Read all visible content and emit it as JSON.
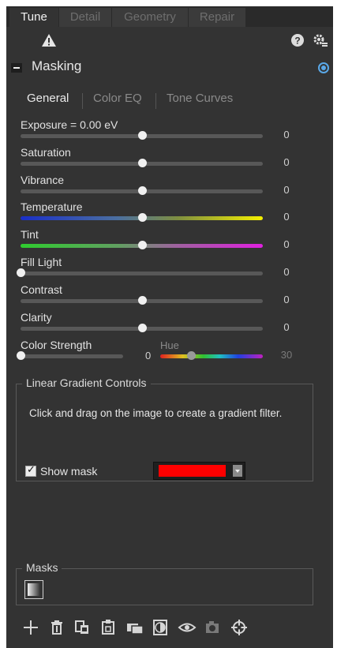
{
  "tabs": [
    "Tune",
    "Detail",
    "Geometry",
    "Repair"
  ],
  "section": {
    "title": "Masking"
  },
  "subtabs": [
    "General",
    "Color EQ",
    "Tone Curves"
  ],
  "sliders": [
    {
      "label": "Exposure = 0.00 eV",
      "value": "0",
      "level": 0.5
    },
    {
      "label": "Saturation",
      "value": "0",
      "level": 0.5
    },
    {
      "label": "Vibrance",
      "value": "0",
      "level": 0.5
    },
    {
      "label": "Temperature",
      "value": "0",
      "level": 0.5,
      "gradient": "temp"
    },
    {
      "label": "Tint",
      "value": "0",
      "level": 0.5,
      "gradient": "tint"
    },
    {
      "label": "Fill Light",
      "value": "0",
      "level": 0.0
    },
    {
      "label": "Contrast",
      "value": "0",
      "level": 0.5
    },
    {
      "label": "Clarity",
      "value": "0",
      "level": 0.5
    }
  ],
  "color_strength": {
    "label": "Color Strength",
    "value": "0",
    "level": 0.0,
    "hue_label": "Hue",
    "hue_value": "30",
    "hue_level": 0.3
  },
  "gradient": {
    "title": "Linear Gradient Controls",
    "hint": "Click and drag on the image to create a gradient filter.",
    "show_mask_label": "Show mask",
    "show_mask_checked": true,
    "mask_color": "#ff0000"
  },
  "masks": {
    "title": "Masks"
  },
  "icons": {
    "warning": "warning-icon",
    "help": "help-icon",
    "settings": "gear-icon",
    "target": "target-icon",
    "toolbar": [
      "add-icon",
      "delete-icon",
      "copy-icon",
      "paste-icon",
      "duplicate-icon",
      "invert-icon",
      "eye-icon",
      "disabled-icon",
      "crosshair-icon"
    ]
  }
}
